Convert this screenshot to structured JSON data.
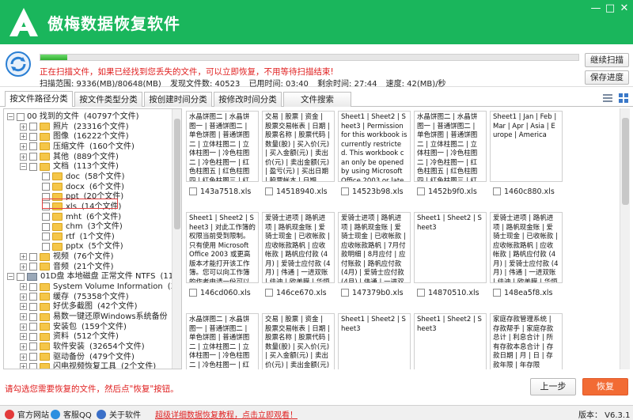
{
  "app": {
    "title": "傲梅数据恢复软件",
    "logo_letter": "A",
    "brand_color": "#1ab65c"
  },
  "window_controls": {
    "minimize": "—",
    "maximize": "□",
    "close": "✕"
  },
  "scan": {
    "progress": 0.05,
    "warning": "正在扫描文件，如果已经找到您丢失的文件，可以立即恢复，不用等待扫描结束!",
    "stats": {
      "range": "扫描范围: 9336(MB)/80648(MB)",
      "found": "发现文件数: 40523",
      "elapsed": "已用时间: 03:40",
      "remaining": "剩余时间: 27:44",
      "speed": "速度: 42(MB)/秒"
    },
    "continue_label": "继续扫描",
    "save_label": "保存进度"
  },
  "tabs": [
    {
      "label": "按文件路径分类"
    },
    {
      "label": "按文件类型分类"
    },
    {
      "label": "按创建时间分类"
    },
    {
      "label": "按修改时间分类"
    },
    {
      "label": "文件搜索"
    }
  ],
  "tree": [
    {
      "indent": 0,
      "expander": "−",
      "icon": "none",
      "label": "00 找到的文件",
      "count": "(40797个文件)"
    },
    {
      "indent": 1,
      "expander": "+",
      "icon": "folder",
      "label": "照片",
      "count": "(23316个文件)"
    },
    {
      "indent": 1,
      "expander": "+",
      "icon": "folder",
      "label": "图像",
      "count": "(16222个文件)"
    },
    {
      "indent": 1,
      "expander": "+",
      "icon": "folder",
      "label": "压缩文件",
      "count": "(160个文件)"
    },
    {
      "indent": 1,
      "expander": "+",
      "icon": "folder",
      "label": "其他",
      "count": "(889个文件)"
    },
    {
      "indent": 1,
      "expander": "−",
      "icon": "folder",
      "label": "文档",
      "count": "(113个文件)"
    },
    {
      "indent": 2,
      "expander": "",
      "icon": "folder",
      "label": "doc",
      "count": "(58个文件)"
    },
    {
      "indent": 2,
      "expander": "",
      "icon": "folder",
      "label": "docx",
      "count": "(6个文件)"
    },
    {
      "indent": 2,
      "expander": "",
      "icon": "folder",
      "label": "ppt",
      "count": "(20个文件)"
    },
    {
      "indent": 2,
      "expander": "",
      "icon": "folder",
      "label": "xls",
      "count": "(14个文件)"
    },
    {
      "indent": 2,
      "expander": "",
      "icon": "folder",
      "label": "mht",
      "count": "(6个文件)"
    },
    {
      "indent": 2,
      "expander": "",
      "icon": "folder",
      "label": "chm",
      "count": "(3个文件)"
    },
    {
      "indent": 2,
      "expander": "",
      "icon": "folder",
      "label": "rtf",
      "count": "(1个文件)"
    },
    {
      "indent": 2,
      "expander": "",
      "icon": "folder",
      "label": "pptx",
      "count": "(5个文件)"
    },
    {
      "indent": 1,
      "expander": "+",
      "icon": "folder",
      "label": "视频",
      "count": "(76个文件)"
    },
    {
      "indent": 1,
      "expander": "+",
      "icon": "folder",
      "label": "音频",
      "count": "(21个文件)"
    },
    {
      "indent": 0,
      "expander": "−",
      "icon": "disk",
      "label": "01D盘 本地磁盘 正常文件 NTFS",
      "count": "(113573个"
    },
    {
      "indent": 1,
      "expander": "+",
      "icon": "folder",
      "label": "System Volume Information",
      "count": "(3个文件)"
    },
    {
      "indent": 1,
      "expander": "+",
      "icon": "folder",
      "label": "缓存",
      "count": "(75358个文件)"
    },
    {
      "indent": 1,
      "expander": "+",
      "icon": "folder",
      "label": "好优多截图",
      "count": "(42个文件)"
    },
    {
      "indent": 1,
      "expander": "+",
      "icon": "folder",
      "label": "易数一键还原Windows系统备份",
      "count": "(不要删"
    },
    {
      "indent": 1,
      "expander": "+",
      "icon": "folder",
      "label": "安装包",
      "count": "(159个文件)"
    },
    {
      "indent": 1,
      "expander": "+",
      "icon": "folder",
      "label": "资料",
      "count": "(512个文件)"
    },
    {
      "indent": 1,
      "expander": "+",
      "icon": "folder",
      "label": "软件安装",
      "count": "(32654个文件)"
    },
    {
      "indent": 1,
      "expander": "+",
      "icon": "folder",
      "label": "驱动备份",
      "count": "(479个文件)"
    },
    {
      "indent": 1,
      "expander": "+",
      "icon": "folder",
      "label": "闪电视频恢复工具",
      "count": "(2个文件)"
    }
  ],
  "files": [
    {
      "name": "143a7518.xls",
      "preview": "水晶饼图二 | 水晶饼图一 | 普通饼图二 | 单色饼图 | 普通饼图二 | 立体柱图二 | 立体柱图一 | 冷色柱图二 | 冷色柱图一 | 红色柱图五 | 红色柱图四 | 红色柱图三 | 红色柱图二 | 红"
    },
    {
      "name": "14518940.xls",
      "preview": "交易 | 股票 | 资金 | 股票交易帐表 | 日期 | 股票名称 | 股票代码 | 数量(股) | 买入价(元) | 买入金额(元) | 卖出价(元) | 卖出金额(元) | 盈亏(元) | 买出日期 | 股票帐本 | 日期"
    },
    {
      "name": "14523b98.xls",
      "preview": "Sheet1 | Sheet2 | Sheet3 | Permission for this workbook is currently restricted. This workbook can only be opened by using Microsoft Office 2003 or later. You can request"
    },
    {
      "name": "1452b9f0.xls",
      "preview": "水晶饼图二 | 水晶饼图一 | 普通饼图二 | 单色饼图 | 普通饼图二 | 立体柱图二 | 立体柱图一 | 冷色柱图二 | 冷色柱图一 | 红色柱图五 | 红色柱图四 | 红色柱图三 | 红色柱图二"
    },
    {
      "name": "1460c880.xls",
      "preview": "Sheet1 | Jan | Feb | Mar | Apr | Asia | Europe | America"
    },
    {
      "name": "146cd060.xls",
      "preview": "Sheet1 | Sheet2 | Sheet3 | 对此工作簿的权限当前受到限制。只有使用 Microsoft Office 2003 或更高版本才能打开该工作簿。您可以向工作簿的作者申请一份可以"
    },
    {
      "name": "146ce670.xls",
      "preview": "爱骑士进项 | 路帆进项 | 路帆现金账 | 爱骑士现金 | 已收帐款 | 应收帐款路帆 | 应收帐款 | 路帆应付款 (4月) | 爱骑士应付款 (4月) | 伟通 | 一进双账 | 佳迪 | 欧美膜 | 华恒膜"
    },
    {
      "name": "147379b0.xls",
      "preview": "爱骑士进项 | 路帆进项 | 路帆现金账 | 爱骑士现金 | 已收帐款 | 应收帐款路帆 | 7月付款明细 | 8月应付 | 应付账款 | 路帆应付款 (4月) | 爱骑士应付款 (4月) | 伟通 | 一进双账"
    },
    {
      "name": "14870510.xls",
      "preview": "Sheet1 | Sheet2 | Sheet3"
    },
    {
      "name": "148ea5f8.xls",
      "preview": "爱骑士进项 | 路帆进项 | 路帆现金账 | 爱骑士现金 | 已收帐款 | 应收帐款路帆 | 应收帐款 | 路帆应付款 (4月) | 爱骑士应付款 (4月) | 伟通 | 一进双账 | 佳迪 | 欧美膜 | 华恒膜"
    },
    {
      "name": "",
      "preview": "水晶饼图二 | 水晶饼图一 | 普通饼图二 | 单色饼图 | 普通饼图二 | 立体柱图二 | 立体柱图一 | 冷色柱图二 | 冷色柱图一 | 红色柱图五 | 红色柱图四 | 红色柱图三"
    },
    {
      "name": "",
      "preview": "交易 | 股票 | 资金 | 股票交易帐表 | 日期 | 股票名称 | 股票代码 | 数量(股) | 买入价(元) | 买入金额(元) | 卖出价(元) | 卖出金额(元)"
    },
    {
      "name": "",
      "preview": "Sheet1 | Sheet2 | Sheet3"
    },
    {
      "name": "",
      "preview": "Sheet1 | Sheet2 | Sheet3"
    },
    {
      "name": "",
      "preview": "家庭存款管理系统 | 存款帮手 | 家庭存款总计 | 利息合计 | 所有存款本息合计 | 存款日期 | 月 | 日 | 存款年限 | 年存限"
    }
  ],
  "footer": {
    "hint": "请勾选您需要恢复的文件，然后点\"恢复\"按钮。",
    "prev_label": "上一步",
    "recover_label": "恢复"
  },
  "statusbar": {
    "website": "官方网站",
    "qq": "客服QQ",
    "about": "关于软件",
    "tutorial": "超级详细数据恢复教程，点击立即观看！",
    "version": "版本： V6.3.1"
  }
}
